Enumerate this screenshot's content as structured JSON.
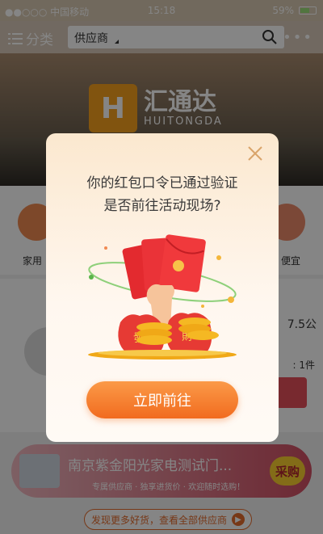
{
  "status_bar": {
    "carrier": "●●○○○ 中国移动",
    "time": "15:18",
    "battery": "59%"
  },
  "header": {
    "category_label": "分类",
    "search_value": "供应商",
    "more_label": "•••"
  },
  "banner": {
    "logo_mark": "H",
    "logo_cn": "汇通达",
    "logo_en": "HUITONGDA"
  },
  "background": {
    "left_label": "家用",
    "right_label": "便宜",
    "price_text": "7.5公",
    "qty_text": ": 1件"
  },
  "bottom_banner": {
    "title": "南京紫金阳光家电测试门...",
    "subtitle": "专属供应商 · 独享进货价 · 欢迎随时选购！",
    "badge": "采购"
  },
  "discover_button": {
    "label": "发现更多好货，查看全部供应商"
  },
  "modal": {
    "line1": "你的红包口令已通过验证",
    "line2": "是否前往活动现场?",
    "confirm_label": "立即前往",
    "bag_left": "發",
    "bag_right": "財"
  },
  "colors": {
    "accent": "#f16b1f",
    "overlay": "#000000",
    "banner_badge": "#fcd02f"
  }
}
